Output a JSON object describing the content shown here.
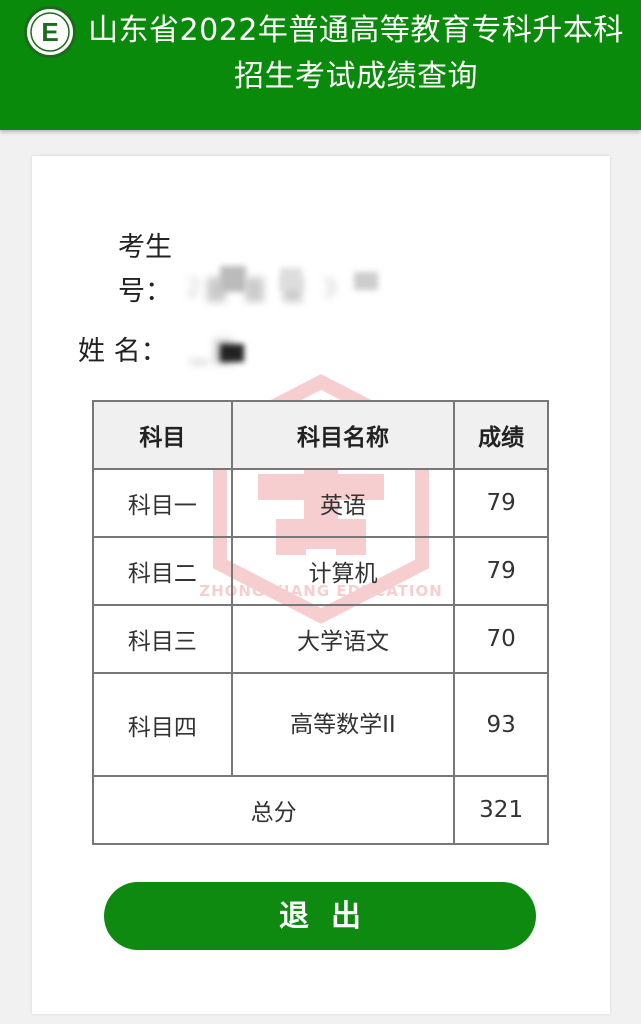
{
  "header": {
    "title": "山东省2022年普通高等教育专科升本科招生考试成绩查询"
  },
  "colors": {
    "primary_green": "#0a8a0a",
    "watermark_red": "#d9262b"
  },
  "candidate": {
    "exam_number_label": "考生号：",
    "exam_number_value": "2▇ ▇  ▇ 3",
    "name_label": "姓 名：",
    "name_value": "▁▇"
  },
  "watermark": {
    "top_text": "中享教育",
    "arc_text": "ZHONG XIANG EDUCATION",
    "registered": "®"
  },
  "table": {
    "headers": [
      "科目",
      "科目名称",
      "成绩"
    ],
    "rows": [
      {
        "subject": "科目一",
        "name": "英语",
        "score": "79"
      },
      {
        "subject": "科目二",
        "name": "计算机",
        "score": "79"
      },
      {
        "subject": "科目三",
        "name": "大学语文",
        "score": "70"
      },
      {
        "subject": "科目四",
        "name": "高等数学II",
        "score": "93"
      }
    ],
    "total_label": "总分",
    "total_score": "321"
  },
  "actions": {
    "logout_label": "退出"
  }
}
